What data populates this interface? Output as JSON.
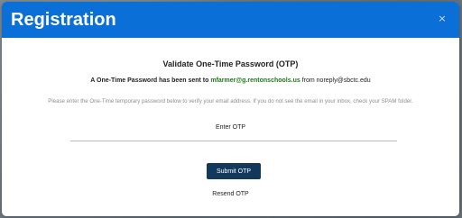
{
  "modal": {
    "title": "Registration",
    "close_icon": "close-icon",
    "close_glyph": "×",
    "colors": {
      "header": "#0a6fd6",
      "submit_button": "#12385c",
      "email_highlight": "#1a7a1a"
    }
  },
  "otp": {
    "heading": "Validate One-Time Password (OTP)",
    "sent_prefix": "A One-Time Password has been sent to",
    "sent_email": "mfarmer@g.rentonschools.us",
    "sent_from_prefix": "from",
    "sent_from": "noreply@sbctc.edu",
    "instructions": "Please enter the One-Time temporary password below to verify your email address. If you do not see the email in your inbox, check your SPAM folder.",
    "input_label": "Enter OTP",
    "input_value": "",
    "submit_label": "Submit OTP",
    "resend_label": "Resend OTP"
  }
}
